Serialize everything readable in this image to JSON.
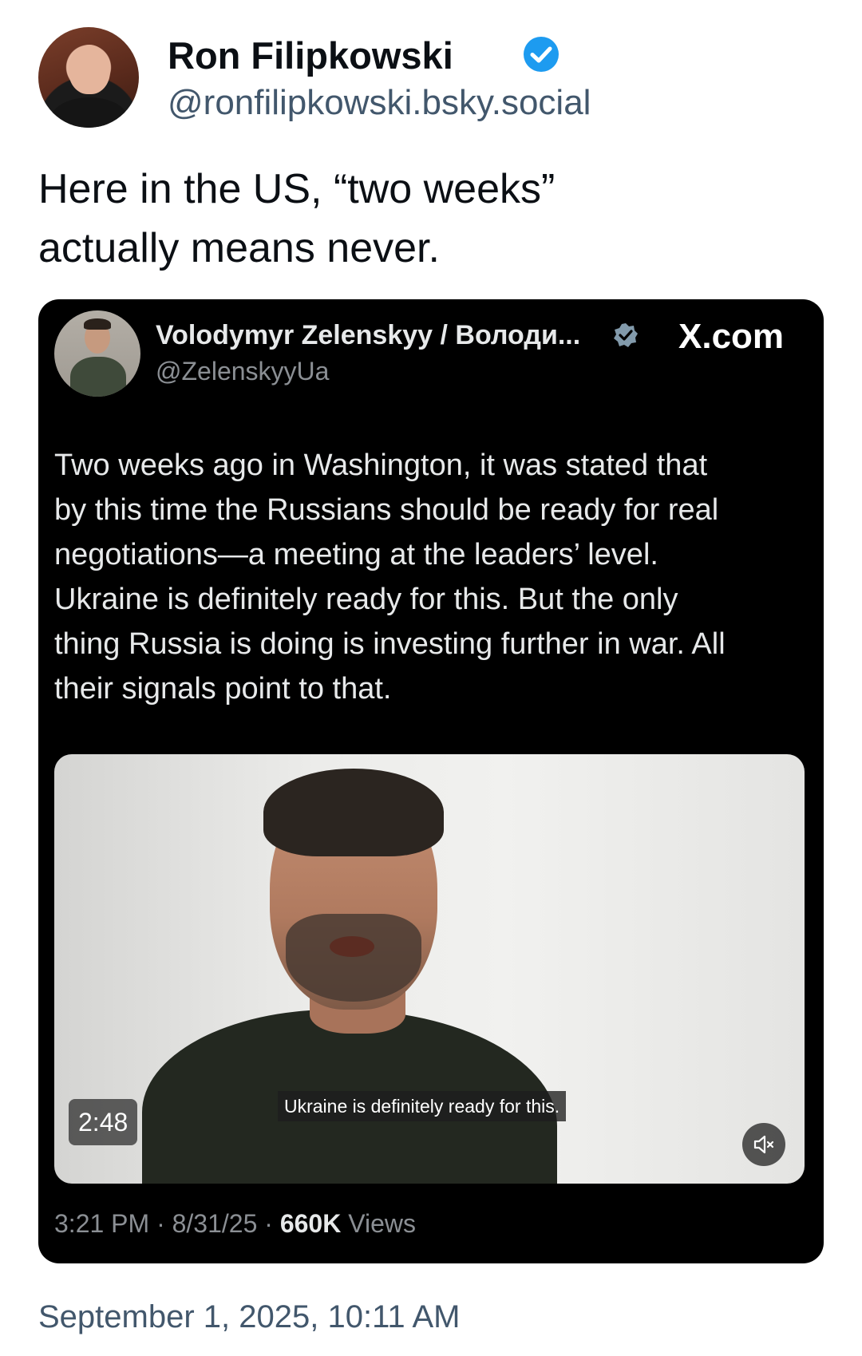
{
  "post": {
    "author": {
      "display_name": "Ron Filipkowski",
      "handle": "@ronfilipkowski.bsky.social",
      "verified_icon": "verified-badge-icon",
      "accent_color": "#1d9bf0"
    },
    "text_line1": "Here in the US, “two weeks”",
    "text_line2": "actually means never.",
    "timestamp": "September 1, 2025, 10:11 AM"
  },
  "embed": {
    "author": {
      "display_name": "Volodymyr Zelenskyy / Володи...",
      "handle": "@ZelenskyyUa",
      "verified_icon": "verified-badge-icon"
    },
    "source_label": "X.com",
    "lines": [
      "Two weeks ago in Washington, it was stated that",
      "by this time the Russians should be ready for real",
      "negotiations—a meeting at the leaders’ level.",
      "Ukraine is definitely ready for this. But the only",
      "thing Russia is doing is investing further in war. All",
      "their signals point to that."
    ],
    "video": {
      "duration": "2:48",
      "caption": "Ukraine is definitely ready for this.",
      "mute_icon": "muted-speaker-icon"
    },
    "meta": {
      "time": "3:21 PM",
      "date": "8/31/25",
      "separator": "·",
      "views_count": "660K",
      "views_label": "Views"
    }
  }
}
